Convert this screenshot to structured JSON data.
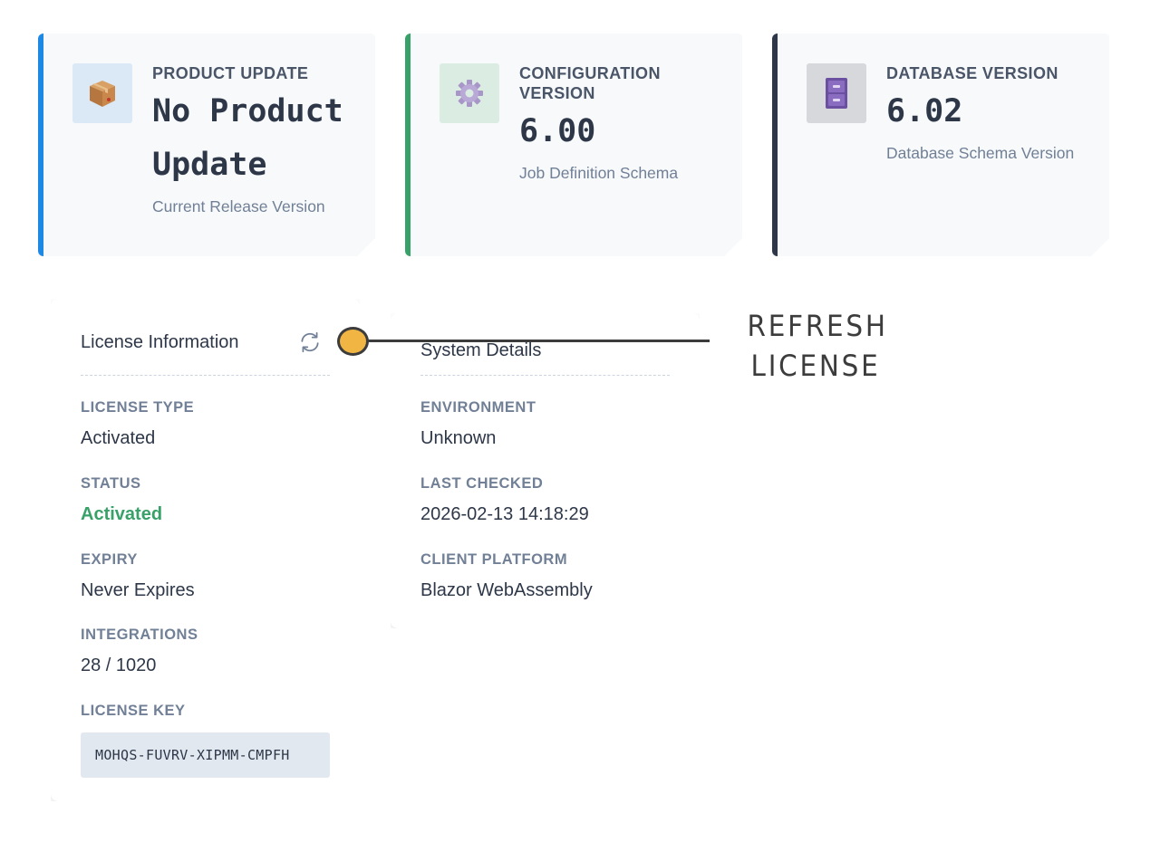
{
  "stats": [
    {
      "label": "PRODUCT UPDATE",
      "value": "No Product Update",
      "subtitle": "Current Release Version",
      "icon": "package-icon",
      "accent": "#1e88e5"
    },
    {
      "label": "CONFIGURATION VERSION",
      "value": "6.00",
      "subtitle": "Job Definition Schema",
      "icon": "gear-icon",
      "accent": "#38a169"
    },
    {
      "label": "DATABASE VERSION",
      "value": "6.02",
      "subtitle": "Database Schema Version",
      "icon": "file-cabinet-icon",
      "accent": "#2d3748"
    }
  ],
  "license": {
    "title": "License Information",
    "refresh_icon": "refresh-icon",
    "fields": [
      {
        "label": "LICENSE TYPE",
        "value": "Activated"
      },
      {
        "label": "STATUS",
        "value": "Activated",
        "color": "#38a169"
      },
      {
        "label": "EXPIRY",
        "value": "Never Expires"
      },
      {
        "label": "INTEGRATIONS",
        "value": "28 / 1020"
      },
      {
        "label": "LICENSE KEY",
        "value": "MOHQS-FUVRV-XIPMM-CMPFH"
      }
    ]
  },
  "system": {
    "title": "System Details",
    "fields": [
      {
        "label": "ENVIRONMENT",
        "value": "Unknown"
      },
      {
        "label": "LAST CHECKED",
        "value": "2026-02-13 14:18:29"
      },
      {
        "label": "CLIENT PLATFORM",
        "value": "Blazor WebAssembly"
      }
    ]
  },
  "annotation": {
    "line1": "REFRESH",
    "line2": "LICENSE",
    "dot_color": "#f0b542"
  }
}
